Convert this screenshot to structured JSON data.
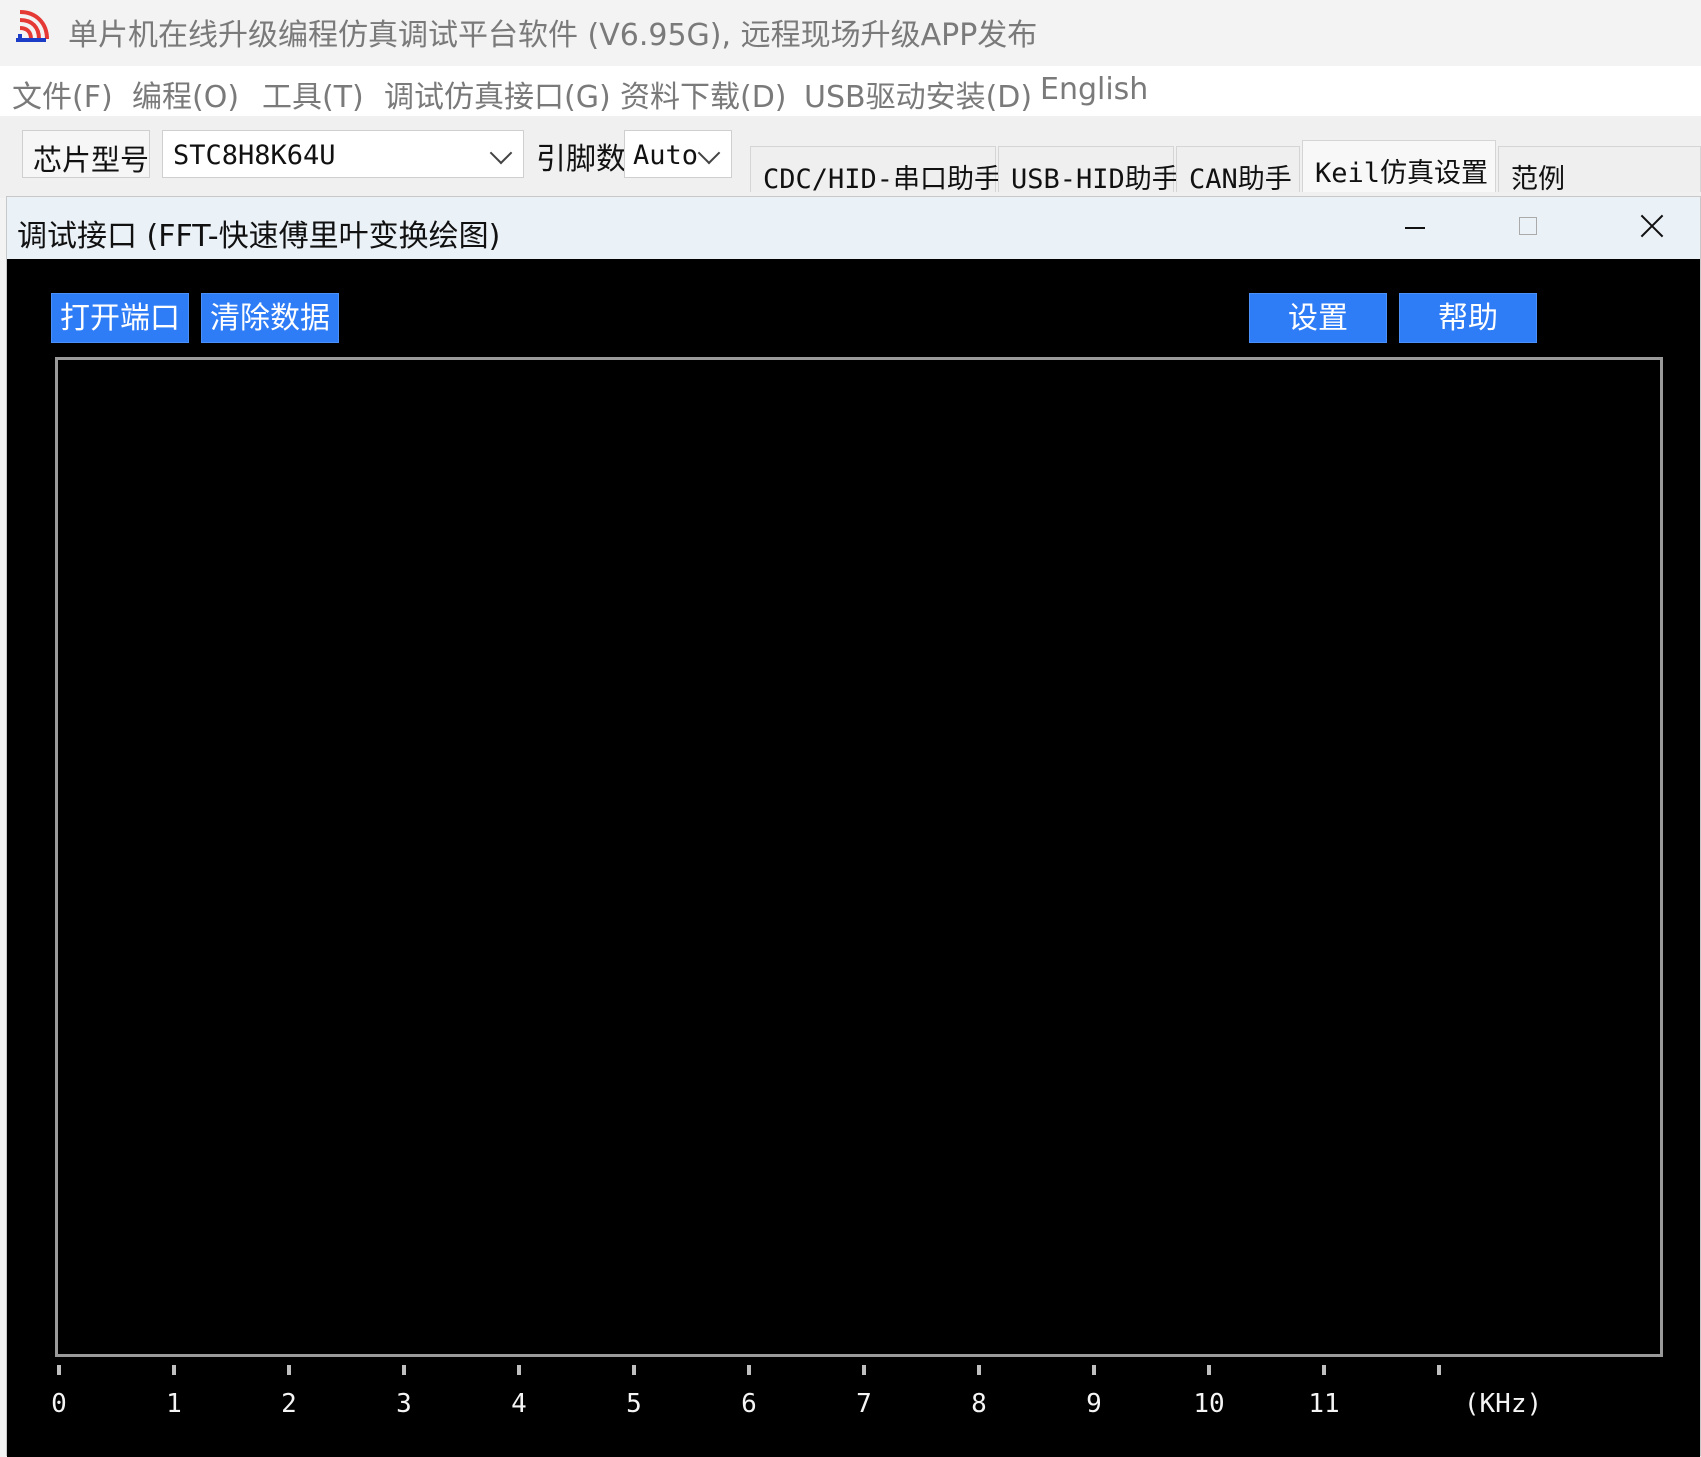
{
  "app": {
    "title": "单片机在线升级编程仿真调试平台软件 (V6.95G), 远程现场升级APP发布",
    "icon": "signal-brand-icon",
    "accent": "#2f7df6"
  },
  "menu": {
    "items": [
      "文件(F)",
      "编程(O)",
      "工具(T)",
      "调试仿真接口(G)",
      "资料下载(D)",
      "USB驱动安装(D)",
      "English"
    ]
  },
  "toolbar": {
    "chip_label": "芯片型号",
    "chip_value": "STC8H8K64U",
    "pins_label": "引脚数",
    "pins_value": "Auto"
  },
  "tabs": [
    "CDC/HID-串口助手",
    "USB-HID助手",
    "CAN助手",
    "Keil仿真设置",
    "范例"
  ],
  "debug_window": {
    "title": "调试接口 (FFT-快速傅里叶变换绘图)",
    "buttons": {
      "open_port": "打开端口",
      "clear_data": "清除数据",
      "settings": "设置",
      "help": "帮助"
    }
  },
  "chart_data": {
    "type": "line",
    "x_ticks": [
      "0",
      "1",
      "2",
      "3",
      "4",
      "5",
      "6",
      "7",
      "8",
      "9",
      "10",
      "11"
    ],
    "x_unit": "(KHz)",
    "series": []
  }
}
